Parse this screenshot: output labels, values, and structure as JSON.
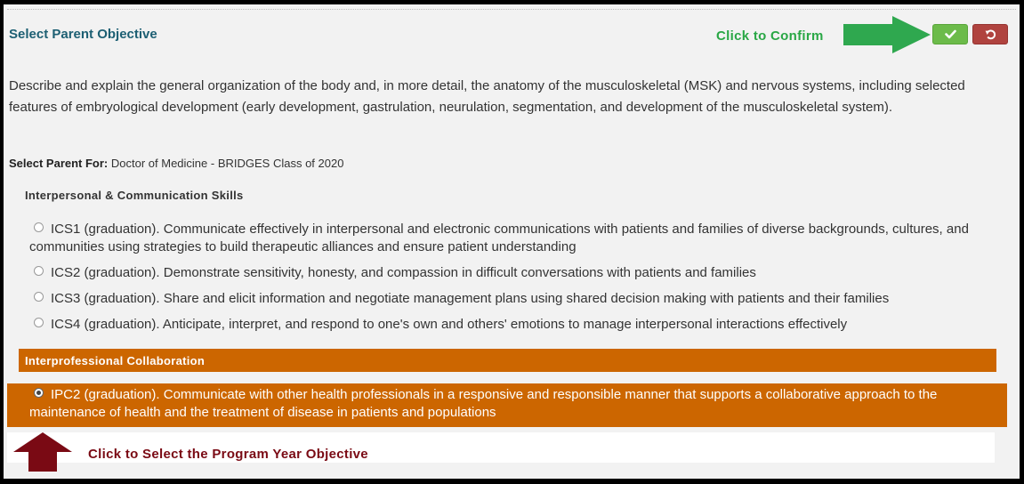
{
  "header": {
    "title": "Select Parent Objective",
    "confirm_annotation": "Click to Confirm",
    "confirm_icon": "check-icon",
    "reset_icon": "undo-icon"
  },
  "description": "Describe and explain the general organization of the body and, in more detail, the anatomy of the musculoskeletal (MSK) and nervous systems, including selected features of embryological development (early development, gastrulation, neurulation, segmentation, and development of the musculoskeletal system).",
  "select_for": {
    "label": "Select Parent For:",
    "value": "Doctor of Medicine - BRIDGES Class of 2020"
  },
  "groups": [
    {
      "heading": "Interpersonal & Communication Skills",
      "options": [
        {
          "text": "ICS1 (graduation). Communicate effectively in interpersonal and electronic communications with patients and families of diverse backgrounds, cultures, and communities using strategies to build therapeutic alliances and ensure patient understanding",
          "selected": false
        },
        {
          "text": "ICS2 (graduation). Demonstrate sensitivity, honesty, and compassion in difficult conversations with patients and families",
          "selected": false
        },
        {
          "text": "ICS3 (graduation). Share and elicit information and negotiate management plans using shared decision making with patients and their families",
          "selected": false
        },
        {
          "text": "ICS4 (graduation). Anticipate, interpret, and respond to one's own and others' emotions to manage interpersonal interactions effectively",
          "selected": false
        }
      ]
    },
    {
      "heading": "Interprofessional Collaboration",
      "options": [
        {
          "text": "IPC2 (graduation). Communicate with other health professionals in a responsive and responsible manner that supports a collaborative approach to the maintenance of health and the treatment of disease in patients and populations",
          "selected": true
        }
      ]
    }
  ],
  "bottom_annotation": "Click to Select the Program Year Objective",
  "colors": {
    "title": "#1d5f73",
    "confirm_green": "#6cbb4a",
    "reset_red": "#b0433f",
    "highlight_orange": "#cc6600",
    "annotation_green": "#29a745",
    "annotation_maroon": "#7a0a14"
  }
}
